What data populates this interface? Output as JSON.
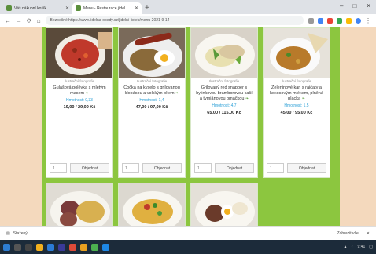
{
  "browser": {
    "tabs": [
      {
        "title": "Váš nákupní košík",
        "active": false
      },
      {
        "title": "Menu - Restaurace jídel",
        "active": true
      }
    ],
    "new_tab": "+",
    "window_controls": [
      "–",
      "□",
      "✕"
    ],
    "nav": [
      "←",
      "→",
      "⟳",
      "⌂"
    ],
    "url": "Bezpečné https://www.jidelna-obedy.cz/jidelni-listek/menu-2021-9-14"
  },
  "menu": {
    "items": [
      {
        "caption": "Ilustrační fotografie",
        "name": "Gulášová polévka s mletým masem",
        "weight": "Hmotnost: 0,33",
        "price": "19,00 / 29,00 Kč",
        "qty_placeholder": "1",
        "order_label": "Objednat",
        "photo": "soup-icon"
      },
      {
        "caption": "Ilustrační fotografie",
        "name": "Čočka na kyselo s grilovanou klobásou a volským okem",
        "weight": "Hmotnost: 1,4",
        "price": "47,00 / 97,00 Kč",
        "qty_placeholder": "1",
        "order_label": "Objednat",
        "photo": "lentils-sausage-egg-icon"
      },
      {
        "caption": "Ilustrační fotografie",
        "name": "Grilovaný red snapper s bylinkovou bramborovou kaší a tymiánovou omáčkou",
        "weight": "Hmotnost: 4,7",
        "price": "65,00 / 115,00 Kč",
        "qty_placeholder": "1",
        "order_label": "Objednat",
        "photo": "fish-puree-icon"
      },
      {
        "caption": "Ilustrační fotografie",
        "name": "Zeleninové kari s rajčaty a kokosovým mlékem, plněná placka",
        "weight": "Hmotnost: 1,5",
        "price": "45,00 / 95,00 Kč",
        "qty_placeholder": "1",
        "order_label": "Objednat",
        "photo": "curry-flatbread-icon"
      },
      {
        "photo": "sausage-pasta-icon"
      },
      {
        "photo": "pasta-salad-icon"
      },
      {
        "photo": "eggs-dumplings-icon"
      }
    ]
  },
  "download_bar": {
    "file": "Stažený",
    "show_all": "Zobrazit vše",
    "close": "✕"
  },
  "taskbar": {
    "clock": "9:41"
  },
  "colors": {
    "page_bg": "#f4d9bd",
    "menu_bg": "#8cc63f",
    "weight_text": "#2a9fd6"
  }
}
